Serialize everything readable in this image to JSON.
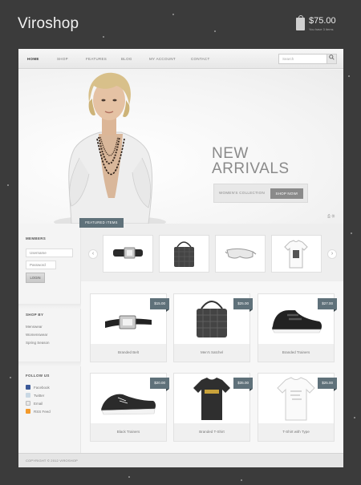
{
  "brand": {
    "logo": "Viroshop"
  },
  "cart": {
    "total": "$75.00",
    "items": "You have 3 items"
  },
  "nav": {
    "items": [
      "HOME",
      "SHOP",
      "FEATURES",
      "BLOG",
      "MY ACCOUNT",
      "CONTACT"
    ],
    "active": "HOME",
    "search_placeholder": "Search"
  },
  "hero": {
    "title_line1": "NEW",
    "title_line2": "ARRIVALS",
    "collection_label": "WOMEN'S COLLECTION",
    "cta_label": "SHOP NOW!"
  },
  "featured": {
    "tab_label": "FEATURED ITEMS",
    "items": [
      "belt-icon",
      "satchel-icon",
      "sunglasses-icon",
      "tshirt-icon"
    ]
  },
  "sidebar": {
    "members_heading": "MEMBERS",
    "username_placeholder": "Username",
    "password_placeholder": "Password",
    "login_label": "LOGIN",
    "shopby_heading": "SHOP BY",
    "shopby_links": [
      "Menswear",
      "Womenswear",
      "Spring Season"
    ],
    "follow_heading": "FOLLOW US",
    "follow_links": [
      "Facebook",
      "Twitter",
      "Email",
      "RSS Feed"
    ]
  },
  "products": [
    {
      "name": "Branded Belt",
      "price": "$15.00"
    },
    {
      "name": "Men's Satchel",
      "price": "$25.00"
    },
    {
      "name": "Branded Trainers",
      "price": "$27.00"
    },
    {
      "name": "Black Trainers",
      "price": "$20.00"
    },
    {
      "name": "Branded T-Shirt",
      "price": "$35.00"
    },
    {
      "name": "T-Shirt with Type",
      "price": "$25.00"
    }
  ],
  "footer": {
    "copyright": "COPYRIGHT © 2012 VIROSHOP"
  },
  "colors": {
    "background": "#3b3b3b",
    "accent": "#5f717a",
    "page": "#f4f4f4"
  }
}
